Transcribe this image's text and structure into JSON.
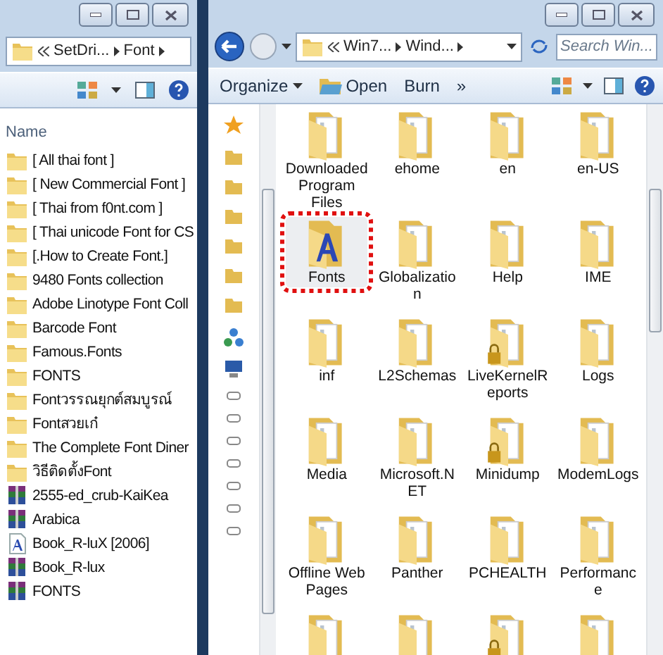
{
  "left_window": {
    "breadcrumbs": [
      "SetDri...",
      "Font"
    ],
    "column_header": "Name",
    "files": [
      {
        "name": "[ All thai font ]",
        "kind": "folder"
      },
      {
        "name": "[ New Commercial Font ]",
        "kind": "folder"
      },
      {
        "name": "[ Thai from f0nt.com ]",
        "kind": "folder"
      },
      {
        "name": "[ Thai unicode Font for CS",
        "kind": "folder"
      },
      {
        "name": "[.How to Create Font.]",
        "kind": "folder"
      },
      {
        "name": "9480 Fonts collection",
        "kind": "folder"
      },
      {
        "name": "Adobe Linotype Font Coll",
        "kind": "folder"
      },
      {
        "name": "Barcode Font",
        "kind": "folder"
      },
      {
        "name": "Famous.Fonts",
        "kind": "folder"
      },
      {
        "name": "FONTS",
        "kind": "folder"
      },
      {
        "name": "Fontวรรณยุกต์สมบูรณ์",
        "kind": "folder"
      },
      {
        "name": "Fontสวยเก๋",
        "kind": "folder"
      },
      {
        "name": "The Complete Font Diner",
        "kind": "folder"
      },
      {
        "name": "วิธีติดตั้งFont",
        "kind": "folder"
      },
      {
        "name": "2555-ed_crub-KaiKea",
        "kind": "archive"
      },
      {
        "name": "Arabica",
        "kind": "archive"
      },
      {
        "name": "Book_R-luX [2006]",
        "kind": "font-file"
      },
      {
        "name": "Book_R-lux",
        "kind": "archive"
      },
      {
        "name": "FONTS",
        "kind": "archive"
      }
    ]
  },
  "right_window": {
    "breadcrumbs": [
      "Win7...",
      "Wind..."
    ],
    "search": {
      "placeholder": "Search Win..."
    },
    "toolbar": [
      {
        "label": "Organize",
        "kind": "menu"
      },
      {
        "label": "Open",
        "kind": "icon"
      },
      {
        "label": "Burn",
        "kind": "plain"
      },
      {
        "label": "»",
        "kind": "plain"
      }
    ],
    "items": [
      {
        "label": "Downloaded Program Files",
        "kind": "folder",
        "locked": false,
        "selected": false
      },
      {
        "label": "ehome",
        "kind": "folder",
        "locked": false,
        "selected": false
      },
      {
        "label": "en",
        "kind": "folder",
        "locked": false,
        "selected": false
      },
      {
        "label": "en-US",
        "kind": "folder",
        "locked": false,
        "selected": false
      },
      {
        "label": "Fonts",
        "kind": "fonts",
        "locked": false,
        "selected": true
      },
      {
        "label": "Globalization",
        "kind": "folder",
        "locked": false,
        "selected": false
      },
      {
        "label": "Help",
        "kind": "folder",
        "locked": false,
        "selected": false
      },
      {
        "label": "IME",
        "kind": "folder",
        "locked": false,
        "selected": false
      },
      {
        "label": "inf",
        "kind": "folder",
        "locked": false,
        "selected": false
      },
      {
        "label": "L2Schemas",
        "kind": "folder",
        "locked": false,
        "selected": false
      },
      {
        "label": "LiveKernelReports",
        "kind": "folder",
        "locked": true,
        "selected": false
      },
      {
        "label": "Logs",
        "kind": "folder",
        "locked": false,
        "selected": false
      },
      {
        "label": "Media",
        "kind": "folder",
        "locked": false,
        "selected": false
      },
      {
        "label": "Microsoft.NET",
        "kind": "folder",
        "locked": false,
        "selected": false
      },
      {
        "label": "Minidump",
        "kind": "folder",
        "locked": true,
        "selected": false
      },
      {
        "label": "ModemLogs",
        "kind": "folder",
        "locked": false,
        "selected": false
      },
      {
        "label": "Offline Web Pages",
        "kind": "folder",
        "locked": false,
        "selected": false
      },
      {
        "label": "Panther",
        "kind": "folder",
        "locked": false,
        "selected": false
      },
      {
        "label": "PCHEALTH",
        "kind": "folder",
        "locked": false,
        "selected": false
      },
      {
        "label": "Performance",
        "kind": "folder",
        "locked": false,
        "selected": false
      },
      {
        "kind": "folder",
        "locked": false,
        "selected": false
      },
      {
        "kind": "folder",
        "locked": false,
        "selected": false
      },
      {
        "kind": "folder",
        "locked": true,
        "selected": false
      },
      {
        "kind": "folder",
        "locked": false,
        "selected": false
      }
    ]
  }
}
